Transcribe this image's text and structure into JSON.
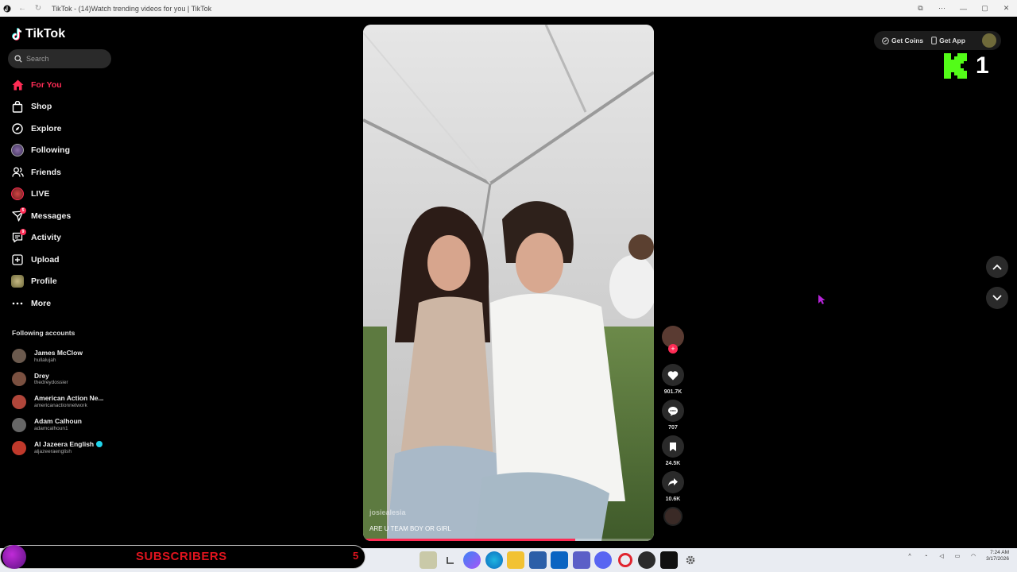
{
  "window": {
    "title": "TikTok - (14)Watch trending videos for you | TikTok"
  },
  "sidebar": {
    "logo": "TikTok",
    "search_placeholder": "Search",
    "nav": [
      {
        "label": "For You",
        "icon": "home-icon",
        "active": true
      },
      {
        "label": "Shop",
        "icon": "shopping-bag-icon"
      },
      {
        "label": "Explore",
        "icon": "compass-icon"
      },
      {
        "label": "Following",
        "icon": "following-avatar-icon"
      },
      {
        "label": "Friends",
        "icon": "friends-icon"
      },
      {
        "label": "LIVE",
        "icon": "live-icon"
      },
      {
        "label": "Messages",
        "icon": "messages-icon",
        "badge": "5"
      },
      {
        "label": "Activity",
        "icon": "activity-icon",
        "badge": "9"
      },
      {
        "label": "Upload",
        "icon": "upload-icon"
      },
      {
        "label": "Profile",
        "icon": "profile-avatar-icon"
      },
      {
        "label": "More",
        "icon": "more-dots-icon"
      }
    ],
    "following_header": "Following accounts",
    "accounts": [
      {
        "name": "James McClow",
        "handle": "hullalujah",
        "color": "#6b5a4e"
      },
      {
        "name": "Drey",
        "handle": "thedreydossier",
        "color": "#7a5040"
      },
      {
        "name": "American Action Ne...",
        "handle": "americanactionnetwork",
        "color": "#b0463a"
      },
      {
        "name": "Adam Calhoun",
        "handle": "adamcalhoun1",
        "color": "#666666"
      },
      {
        "name": "Al Jazeera English",
        "handle": "aljazeeraenglish",
        "color": "#c0392b",
        "verified": true
      }
    ]
  },
  "video": {
    "username": "josiealesia",
    "caption": "ARE U TEAM BOY OR GIRL",
    "progress": 0.73
  },
  "actions": {
    "likes": "901.7K",
    "comments": "707",
    "saves": "24.5K",
    "shares": "10.6K"
  },
  "top_right": {
    "coins_label": "Get Coins",
    "app_label": "Get App"
  },
  "overlay": {
    "kick_count": "1",
    "subscribers_label": "SUBSCRIBERS",
    "subscribers_count": "5"
  },
  "taskbar": {
    "time": "7:24 AM",
    "date": "3/17/2026"
  },
  "colors": {
    "accent": "#fe2c55",
    "kick_green": "#53fc18",
    "subscribers_red": "#e0141e"
  }
}
